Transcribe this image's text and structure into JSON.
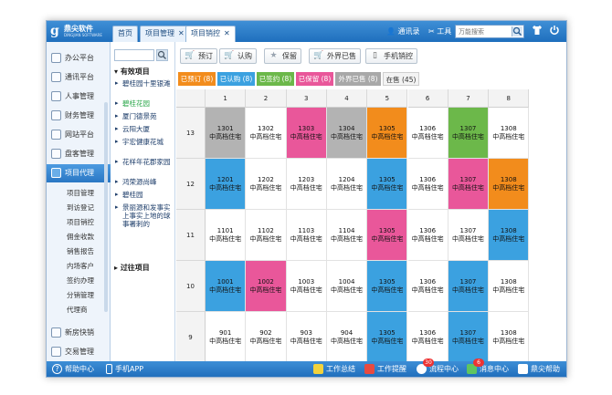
{
  "topbar": {
    "logo_name": "鼎尖软件",
    "logo_sub": "DINGJIAN SOFTWARE",
    "tabs": [
      {
        "label": "首页",
        "closable": false,
        "active": false
      },
      {
        "label": "项目管理",
        "closable": true,
        "active": false
      },
      {
        "label": "项目销控",
        "closable": true,
        "active": true
      }
    ],
    "address_book": "通讯录",
    "tools": "工具",
    "search_placeholder": "万能搜索"
  },
  "leftnav": {
    "items": [
      {
        "label": "办公平台",
        "icon": "office-icon"
      },
      {
        "label": "通讯平台",
        "icon": "communication-icon"
      },
      {
        "label": "人事管理",
        "icon": "personnel-icon"
      },
      {
        "label": "财务管理",
        "icon": "finance-icon"
      },
      {
        "label": "网站平台",
        "icon": "website-icon"
      },
      {
        "label": "盘客管理",
        "icon": "customer-icon"
      },
      {
        "label": "项目代理",
        "icon": "project-agent-icon",
        "active": true
      }
    ],
    "sub_items": [
      "项目管理",
      "到访登记",
      "项目销控",
      "佣金收款",
      "销售报告",
      "内场客户",
      "签约办理",
      "分销管理",
      "代理商"
    ],
    "bottom_items": [
      {
        "label": "新房快销",
        "icon": "new-house-icon"
      },
      {
        "label": "交易管理",
        "icon": "trade-icon"
      }
    ]
  },
  "tree": {
    "active_head": "有效项目",
    "items": [
      "碧桂园十里银滩",
      "碧桂花园",
      "厦门德景苑",
      "云阳大厦",
      "宇宏健康花城",
      "花样年花郡家园",
      "鸿荣源尚峰",
      "碧桂园",
      "景丽源和发事实上事实上地的球事署刺的"
    ],
    "selected_index": 1,
    "past_head": "过往项目"
  },
  "toolbar": {
    "buttons": [
      {
        "label": "预订",
        "icon": "cart-icon",
        "color": "#e6a21d"
      },
      {
        "label": "认购",
        "icon": "cart-green-icon",
        "color": "#4aa34a"
      },
      {
        "label": "保留",
        "icon": "star-icon",
        "color": "#9aa5b1"
      },
      {
        "label": "外界已售",
        "icon": "cart-red-icon",
        "color": "#d43c3c"
      },
      {
        "label": "手机销控",
        "icon": "mobile-icon",
        "color": "#555555"
      }
    ]
  },
  "status_tabs": [
    {
      "label": "已预订 (8)",
      "color": "#f28c1c"
    },
    {
      "label": "已认购 (8)",
      "color": "#3ba1e0"
    },
    {
      "label": "已签约 (8)",
      "color": "#6cb84a"
    },
    {
      "label": "已保留 (8)",
      "color": "#e9579a"
    },
    {
      "label": "外界已售 (8)",
      "color": "#a8a8a8"
    },
    {
      "label": "在售 (45)",
      "color": "#f3f3f3"
    }
  ],
  "colors": {
    "booked": "#f28c1c",
    "subscribed": "#3ba1e0",
    "signed": "#6cb84a",
    "reserved": "#e9579a",
    "sold_outside": "#b3b3b3",
    "on_sale": "#ffffff"
  },
  "grid": {
    "columns": [
      "1",
      "2",
      "3",
      "4",
      "5",
      "6",
      "7",
      "8"
    ],
    "unit_type": "中高档住宅",
    "floors": [
      {
        "floor": "13",
        "units": [
          {
            "no": "1301",
            "status": "sold_outside"
          },
          {
            "no": "1302",
            "status": "on_sale"
          },
          {
            "no": "1303",
            "status": "reserved"
          },
          {
            "no": "1304",
            "status": "sold_outside"
          },
          {
            "no": "1305",
            "status": "booked"
          },
          {
            "no": "1306",
            "status": "on_sale"
          },
          {
            "no": "1307",
            "status": "signed"
          },
          {
            "no": "1308",
            "status": "on_sale"
          }
        ]
      },
      {
        "floor": "12",
        "units": [
          {
            "no": "1201",
            "status": "subscribed"
          },
          {
            "no": "1202",
            "status": "on_sale"
          },
          {
            "no": "1203",
            "status": "on_sale"
          },
          {
            "no": "1204",
            "status": "on_sale"
          },
          {
            "no": "1305",
            "status": "subscribed"
          },
          {
            "no": "1306",
            "status": "on_sale"
          },
          {
            "no": "1307",
            "status": "reserved"
          },
          {
            "no": "1308",
            "status": "booked"
          }
        ]
      },
      {
        "floor": "11",
        "units": [
          {
            "no": "1101",
            "status": "on_sale"
          },
          {
            "no": "1102",
            "status": "on_sale"
          },
          {
            "no": "1103",
            "status": "on_sale"
          },
          {
            "no": "1104",
            "status": "on_sale"
          },
          {
            "no": "1305",
            "status": "reserved"
          },
          {
            "no": "1306",
            "status": "on_sale"
          },
          {
            "no": "1307",
            "status": "on_sale"
          },
          {
            "no": "1308",
            "status": "subscribed"
          }
        ]
      },
      {
        "floor": "10",
        "units": [
          {
            "no": "1001",
            "status": "subscribed"
          },
          {
            "no": "1002",
            "status": "reserved"
          },
          {
            "no": "1003",
            "status": "on_sale"
          },
          {
            "no": "1004",
            "status": "on_sale"
          },
          {
            "no": "1305",
            "status": "subscribed"
          },
          {
            "no": "1306",
            "status": "on_sale"
          },
          {
            "no": "1307",
            "status": "subscribed"
          },
          {
            "no": "1308",
            "status": "on_sale"
          }
        ]
      },
      {
        "floor": "9",
        "units": [
          {
            "no": "901",
            "status": "on_sale"
          },
          {
            "no": "902",
            "status": "on_sale"
          },
          {
            "no": "903",
            "status": "on_sale"
          },
          {
            "no": "904",
            "status": "on_sale"
          },
          {
            "no": "1305",
            "status": "subscribed"
          },
          {
            "no": "1306",
            "status": "on_sale"
          },
          {
            "no": "1307",
            "status": "subscribed"
          },
          {
            "no": "1308",
            "status": "on_sale"
          }
        ]
      }
    ]
  },
  "bottombar": {
    "help": "帮助中心",
    "mobile_app": "手机APP",
    "work_summary": "工作总结",
    "work_reminder": "工作提醒",
    "process_center": "流程中心",
    "process_badge": "30",
    "message_center": "消息中心",
    "message_badge": "6",
    "dingjian_help": "鼎尖帮助"
  }
}
